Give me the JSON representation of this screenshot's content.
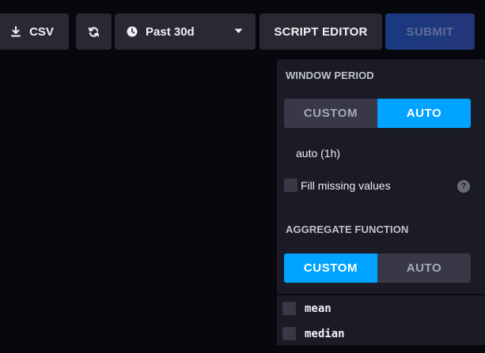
{
  "toolbar": {
    "csv_label": "CSV",
    "time_range_label": "Past 30d",
    "script_editor_label": "SCRIPT EDITOR",
    "submit_label": "SUBMIT"
  },
  "window_period": {
    "title": "WINDOW PERIOD",
    "options": [
      "CUSTOM",
      "AUTO"
    ],
    "selected": "AUTO",
    "value": "auto (1h)",
    "fill_missing_label": "Fill missing values",
    "fill_missing_checked": false,
    "help_glyph": "?"
  },
  "aggregate_function": {
    "title": "AGGREGATE FUNCTION",
    "options": [
      "CUSTOM",
      "AUTO"
    ],
    "selected": "CUSTOM",
    "functions": [
      "mean",
      "median"
    ]
  },
  "icons": {
    "csv": "download-icon",
    "refresh": "refresh-icon",
    "time_range": "clock-icon",
    "dropdown": "chevron-down-icon",
    "help": "help-icon"
  },
  "colors": {
    "accent": "#00a3ff",
    "background": "#07070e",
    "panel": "#1b1b26",
    "button": "#292933",
    "submit_disabled": "#1a3a80"
  }
}
